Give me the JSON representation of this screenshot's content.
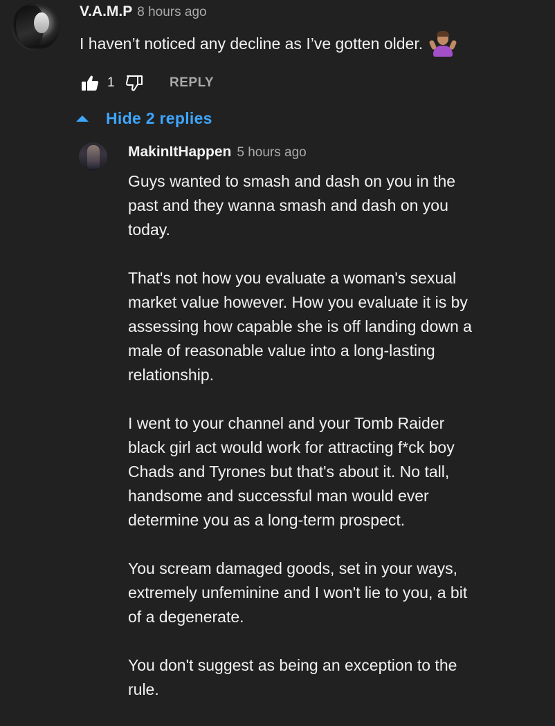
{
  "colors": {
    "background": "#212121",
    "primary_text": "#f1f1f1",
    "secondary_text": "#aaaaaa",
    "link_blue": "#3ea6ff"
  },
  "comment": {
    "author": "V.A.M.P",
    "time": "8 hours ago",
    "text": "I haven’t noticed any decline as I’ve gotten older.",
    "emoji": "shrug-emoji",
    "like_count": "1",
    "reply_label": "REPLY",
    "like_icon": "thumbs-up-icon",
    "dislike_icon": "thumbs-down-icon"
  },
  "replies_toggle": {
    "label": "Hide 2 replies",
    "icon": "caret-up-icon"
  },
  "reply": {
    "author": "MakinItHappen",
    "time": "5 hours ago",
    "paragraphs": [
      [
        "Guys wanted to smash and dash on you in the",
        "past and they wanna smash and dash on you",
        "today."
      ],
      [
        "That's not how you evaluate a woman's sexual",
        "market value however. How you evaluate it is by",
        "assessing how capable she is off landing down a",
        "male of reasonable value into a long-lasting",
        "relationship."
      ],
      [
        "I went to your channel and your Tomb Raider",
        "black girl act would work for attracting f*ck boy",
        "Chads and Tyrones but that's about it. No tall,",
        "handsome and successful man would ever",
        "determine you as a long-term prospect."
      ],
      [
        "You scream damaged goods, set in your ways,",
        "extremely unfeminine and I won't lie to you, a bit",
        "of a degenerate."
      ],
      [
        "You don't suggest as being an exception to the",
        "rule."
      ]
    ]
  }
}
